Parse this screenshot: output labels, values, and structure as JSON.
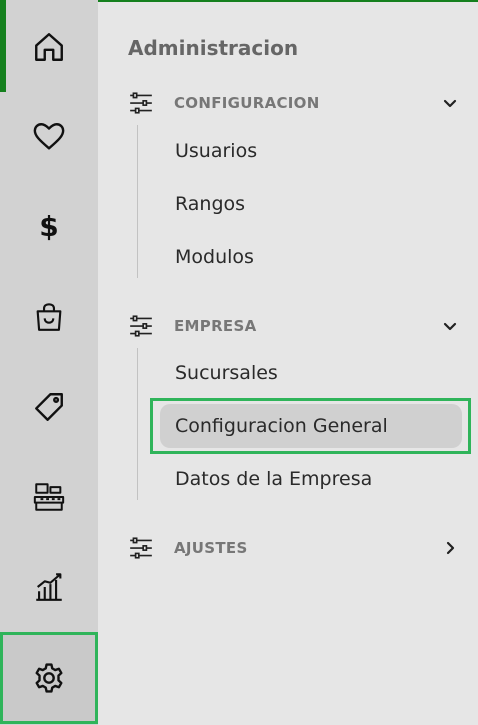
{
  "rail": {
    "items": [
      {
        "icon": "home-icon"
      },
      {
        "icon": "heart-icon"
      },
      {
        "icon": "dollar-icon",
        "glyph": "$"
      },
      {
        "icon": "shopping-bag-icon"
      },
      {
        "icon": "tag-icon"
      },
      {
        "icon": "cash-register-icon"
      },
      {
        "icon": "bar-chart-icon"
      },
      {
        "icon": "gear-icon"
      }
    ],
    "active_index": 7
  },
  "panel": {
    "title": "Administracion",
    "sections": [
      {
        "label": "CONFIGURACION",
        "expanded": true,
        "items": [
          "Usuarios",
          "Rangos",
          "Modulos"
        ]
      },
      {
        "label": "EMPRESA",
        "expanded": true,
        "items": [
          "Sucursales",
          "Configuracion General",
          "Datos de la Empresa"
        ],
        "selected": "Configuracion General"
      },
      {
        "label": "AJUSTES",
        "expanded": false,
        "items": []
      }
    ]
  },
  "colors": {
    "accent_green": "#15801e",
    "highlight_green": "#2fb45a",
    "rail_bg": "#d2d2d2",
    "panel_bg": "#e6e6e6"
  }
}
